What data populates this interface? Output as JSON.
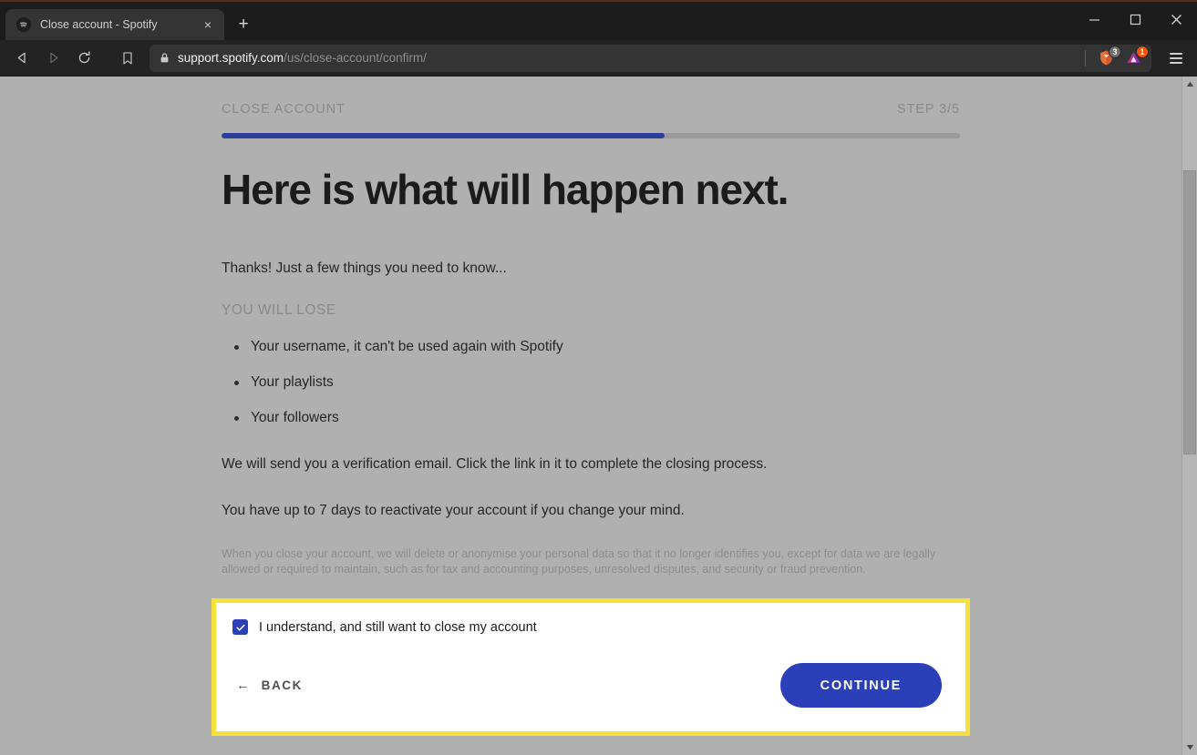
{
  "browser": {
    "tab": {
      "title": "Close account - Spotify",
      "favicon": "spotify-icon",
      "close": "×"
    },
    "new_tab_label": "+",
    "window_controls": {
      "minimize": "minimize-icon",
      "maximize": "maximize-icon",
      "close": "close-icon"
    },
    "nav": {
      "back": "back-arrow-icon",
      "forward": "forward-arrow-icon",
      "reload": "reload-icon",
      "bookmark": "bookmark-icon"
    },
    "url": {
      "domain": "support.spotify.com",
      "path": "/us/close-account/confirm/",
      "lock": "lock-icon"
    },
    "extensions": [
      {
        "name": "brave-shields-icon",
        "badge": "3",
        "badge_color": "#6d6d6d"
      },
      {
        "name": "adblock-triangle-icon",
        "badge": "1",
        "badge_color": "#f2530b"
      }
    ],
    "menu_label": "hamburger-menu-icon"
  },
  "page": {
    "flow_label": "CLOSE ACCOUNT",
    "step_label": "STEP 3/5",
    "progress_percent": 60,
    "headline": "Here is what will happen next.",
    "intro": "Thanks! Just a few things you need to know...",
    "lose_subhead": "YOU WILL LOSE",
    "lose_items": [
      "Your username, it can't be used again with Spotify",
      "Your playlists",
      "Your followers"
    ],
    "paragraphs": [
      "We will send you a verification email. Click the link in it to complete the closing process.",
      "You have up to 7 days to reactivate your account if you change your mind."
    ],
    "legal": "When you close your account, we will delete or anonymise your personal data so that it no longer identifies you, except for data we are legally allowed or required to maintain, such as for tax and accounting purposes, unresolved disputes, and security or fraud prevention.",
    "action": {
      "checkbox_checked": true,
      "checkbox_label": "I understand, and still want to close my account",
      "back_label": "BACK",
      "back_arrow": "←",
      "continue_label": "CONTINUE"
    }
  },
  "colors": {
    "accent_blue": "#2b3fb8",
    "progress_blue": "#2a3f9c",
    "highlight_yellow": "#f4e23b",
    "overlay_gray": "#b0b0b0"
  }
}
